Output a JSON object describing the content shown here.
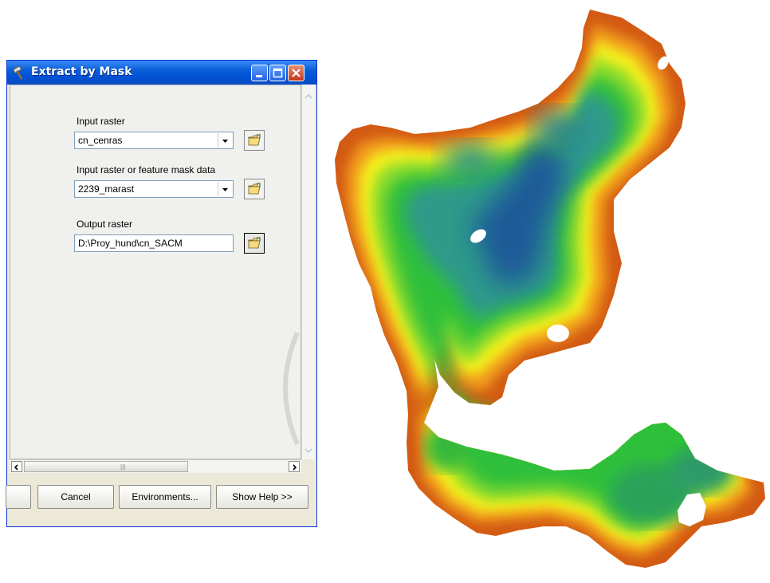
{
  "dialog": {
    "title": "Extract by Mask",
    "title_icon": "hammer-icon",
    "fields": [
      {
        "label": "Input raster",
        "value": "cn_cenras",
        "kind": "combo"
      },
      {
        "label": "Input raster or feature mask data",
        "value": "2239_marast",
        "kind": "combo"
      },
      {
        "label": "Output raster",
        "value": "D:\\Proy_hund\\cn_SACM",
        "kind": "text"
      }
    ],
    "buttons": {
      "cancel": "Cancel",
      "environments": "Environments...",
      "show_help": "Show Help >>"
    }
  },
  "map": {
    "type": "raster-surface",
    "color_ramp": [
      "#1f5a99",
      "#2e8a9a",
      "#28b04a",
      "#8ee02a",
      "#f6f11c",
      "#f2a21a",
      "#d85a12"
    ]
  }
}
